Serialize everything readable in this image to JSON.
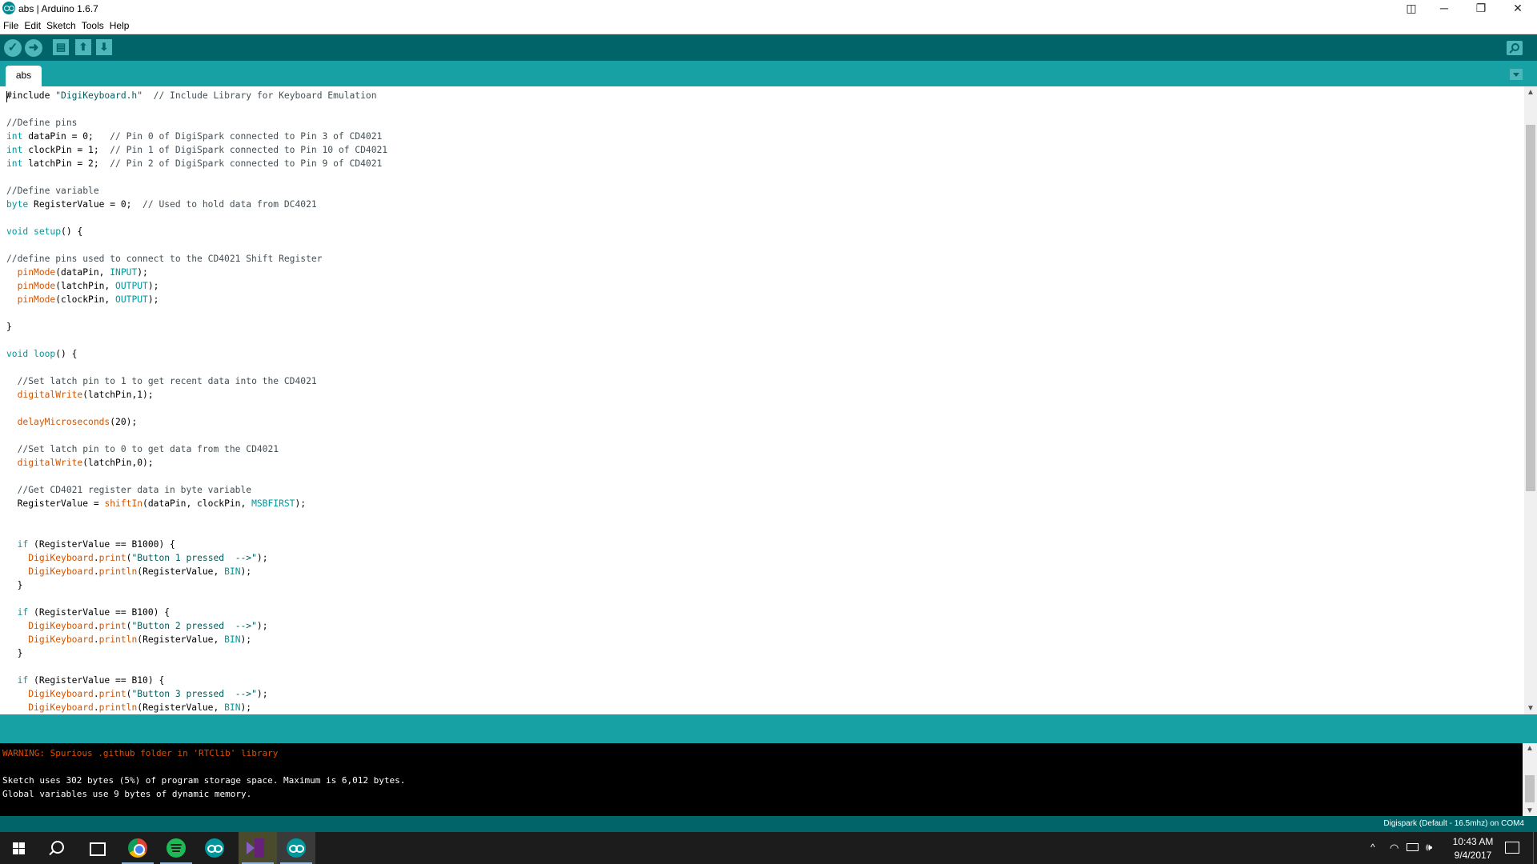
{
  "window": {
    "title": "abs | Arduino 1.6.7"
  },
  "window_controls": {
    "snap": "◫",
    "minimize": "─",
    "maximize": "❐",
    "close": "✕"
  },
  "menu": [
    "File",
    "Edit",
    "Sketch",
    "Tools",
    "Help"
  ],
  "toolbar": {
    "buttons": [
      {
        "name": "verify-button",
        "icon": "check-icon",
        "glyph": "✓"
      },
      {
        "name": "upload-button",
        "icon": "arrow-right-icon",
        "glyph": "➜"
      },
      {
        "name": "new-button",
        "icon": "new-file-icon",
        "glyph": "▤"
      },
      {
        "name": "open-button",
        "icon": "arrow-up-icon",
        "glyph": "⬆"
      },
      {
        "name": "save-button",
        "icon": "arrow-down-icon",
        "glyph": "⬇"
      }
    ],
    "serial_monitor_icon": "magnifier-icon"
  },
  "tabs": [
    {
      "label": "abs",
      "active": true
    }
  ],
  "editor": {
    "lines": [
      [
        [
          "pp",
          "#include "
        ],
        [
          "str",
          "\"DigiKeyboard.h\""
        ],
        [
          "t",
          "  "
        ],
        [
          "cmt",
          "// Include Library for Keyboard Emulation"
        ]
      ],
      [],
      [
        [
          "cmt",
          "//Define pins"
        ]
      ],
      [
        [
          "kw",
          "int"
        ],
        [
          "t",
          " dataPin = 0;   "
        ],
        [
          "cmt",
          "// Pin 0 of DigiSpark connected to Pin 3 of CD4021"
        ]
      ],
      [
        [
          "kw",
          "int"
        ],
        [
          "t",
          " clockPin = 1;  "
        ],
        [
          "cmt",
          "// Pin 1 of DigiSpark connected to Pin 10 of CD4021"
        ]
      ],
      [
        [
          "kw",
          "int"
        ],
        [
          "t",
          " latchPin = 2;  "
        ],
        [
          "cmt",
          "// Pin 2 of DigiSpark connected to Pin 9 of CD4021"
        ]
      ],
      [],
      [
        [
          "cmt",
          "//Define variable"
        ]
      ],
      [
        [
          "kw",
          "byte"
        ],
        [
          "t",
          " RegisterValue = 0;  "
        ],
        [
          "cmt",
          "// Used to hold data from DC4021"
        ]
      ],
      [],
      [
        [
          "kw",
          "void"
        ],
        [
          "t",
          " "
        ],
        [
          "kw",
          "setup"
        ],
        [
          "t",
          "() {"
        ]
      ],
      [],
      [
        [
          "cmt",
          "//define pins used to connect to the CD4021 Shift Register"
        ]
      ],
      [
        [
          "t",
          "  "
        ],
        [
          "fn",
          "pinMode"
        ],
        [
          "t",
          "(dataPin, "
        ],
        [
          "kw",
          "INPUT"
        ],
        [
          "t",
          ");"
        ]
      ],
      [
        [
          "t",
          "  "
        ],
        [
          "fn",
          "pinMode"
        ],
        [
          "t",
          "(latchPin, "
        ],
        [
          "kw",
          "OUTPUT"
        ],
        [
          "t",
          ");"
        ]
      ],
      [
        [
          "t",
          "  "
        ],
        [
          "fn",
          "pinMode"
        ],
        [
          "t",
          "(clockPin, "
        ],
        [
          "kw",
          "OUTPUT"
        ],
        [
          "t",
          ");"
        ]
      ],
      [],
      [
        [
          "t",
          "}"
        ]
      ],
      [],
      [
        [
          "kw",
          "void"
        ],
        [
          "t",
          " "
        ],
        [
          "kw",
          "loop"
        ],
        [
          "t",
          "() {"
        ]
      ],
      [],
      [
        [
          "t",
          "  "
        ],
        [
          "cmt",
          "//Set latch pin to 1 to get recent data into the CD4021"
        ]
      ],
      [
        [
          "t",
          "  "
        ],
        [
          "fn",
          "digitalWrite"
        ],
        [
          "t",
          "(latchPin,1);"
        ]
      ],
      [],
      [
        [
          "t",
          "  "
        ],
        [
          "fn",
          "delayMicroseconds"
        ],
        [
          "t",
          "(20);"
        ]
      ],
      [],
      [
        [
          "t",
          "  "
        ],
        [
          "cmt",
          "//Set latch pin to 0 to get data from the CD4021"
        ]
      ],
      [
        [
          "t",
          "  "
        ],
        [
          "fn",
          "digitalWrite"
        ],
        [
          "t",
          "(latchPin,0);"
        ]
      ],
      [],
      [
        [
          "t",
          "  "
        ],
        [
          "cmt",
          "//Get CD4021 register data in byte variable"
        ]
      ],
      [
        [
          "t",
          "  RegisterValue = "
        ],
        [
          "fn",
          "shiftIn"
        ],
        [
          "t",
          "(dataPin, clockPin, "
        ],
        [
          "kw",
          "MSBFIRST"
        ],
        [
          "t",
          ");"
        ]
      ],
      [],
      [],
      [
        [
          "t",
          "  "
        ],
        [
          "kw",
          "if"
        ],
        [
          "t",
          " (RegisterValue == B1000) {"
        ]
      ],
      [
        [
          "t",
          "    "
        ],
        [
          "fn",
          "DigiKeyboard"
        ],
        [
          "t",
          "."
        ],
        [
          "fn",
          "print"
        ],
        [
          "t",
          "("
        ],
        [
          "str",
          "\"Button 1 pressed  -->\""
        ],
        [
          "t",
          ");"
        ]
      ],
      [
        [
          "t",
          "    "
        ],
        [
          "fn",
          "DigiKeyboard"
        ],
        [
          "t",
          "."
        ],
        [
          "fn",
          "println"
        ],
        [
          "t",
          "(RegisterValue, "
        ],
        [
          "kw",
          "BIN"
        ],
        [
          "t",
          ");"
        ]
      ],
      [
        [
          "t",
          "  }"
        ]
      ],
      [],
      [
        [
          "t",
          "  "
        ],
        [
          "kw",
          "if"
        ],
        [
          "t",
          " (RegisterValue == B100) {"
        ]
      ],
      [
        [
          "t",
          "    "
        ],
        [
          "fn",
          "DigiKeyboard"
        ],
        [
          "t",
          "."
        ],
        [
          "fn",
          "print"
        ],
        [
          "t",
          "("
        ],
        [
          "str",
          "\"Button 2 pressed  -->\""
        ],
        [
          "t",
          ");"
        ]
      ],
      [
        [
          "t",
          "    "
        ],
        [
          "fn",
          "DigiKeyboard"
        ],
        [
          "t",
          "."
        ],
        [
          "fn",
          "println"
        ],
        [
          "t",
          "(RegisterValue, "
        ],
        [
          "kw",
          "BIN"
        ],
        [
          "t",
          ");"
        ]
      ],
      [
        [
          "t",
          "  }"
        ]
      ],
      [],
      [
        [
          "t",
          "  "
        ],
        [
          "kw",
          "if"
        ],
        [
          "t",
          " (RegisterValue == B10) {"
        ]
      ],
      [
        [
          "t",
          "    "
        ],
        [
          "fn",
          "DigiKeyboard"
        ],
        [
          "t",
          "."
        ],
        [
          "fn",
          "print"
        ],
        [
          "t",
          "("
        ],
        [
          "str",
          "\"Button 3 pressed  -->\""
        ],
        [
          "t",
          ");"
        ]
      ],
      [
        [
          "t",
          "    "
        ],
        [
          "fn",
          "DigiKeyboard"
        ],
        [
          "t",
          "."
        ],
        [
          "fn",
          "println"
        ],
        [
          "t",
          "(RegisterValue, "
        ],
        [
          "kw",
          "BIN"
        ],
        [
          "t",
          ");"
        ]
      ]
    ]
  },
  "console": {
    "warning": "WARNING: Spurious .github folder in 'RTClib' library",
    "line_blank": "",
    "line1": "Sketch uses 302 bytes (5%) of program storage space. Maximum is 6,012 bytes.",
    "line2": "Global variables use 9 bytes of dynamic memory."
  },
  "status": {
    "board": "Digispark (Default - 16.5mhz) on COM4"
  },
  "taskbar": {
    "apps": [
      "start",
      "search",
      "task-view",
      "chrome",
      "spotify",
      "arduino",
      "visual-studio",
      "arduino"
    ],
    "tray": {
      "chevron": "^",
      "network": "◠",
      "volume": "🕪"
    },
    "clock": {
      "time": "10:43 AM",
      "date": "9/4/2017"
    }
  }
}
